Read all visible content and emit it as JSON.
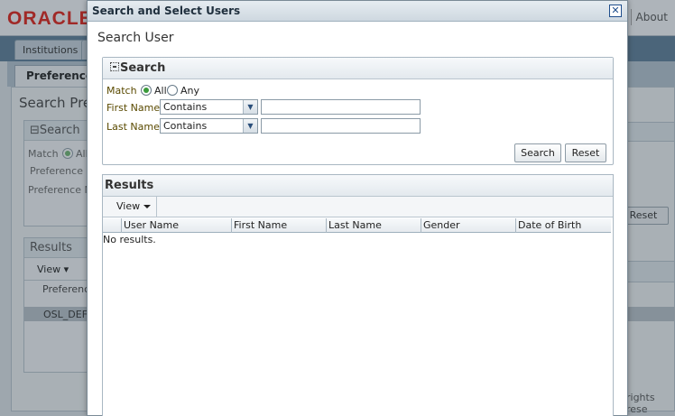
{
  "background_app": {
    "logo_text": "ORACLE",
    "about_link": "About",
    "tabs": [
      "Institutions"
    ],
    "subtab": "Preference",
    "page_title": "Search Pre",
    "search_box_title": "Search",
    "match_label": "Match",
    "match_all": "All",
    "pref_label_1": "Preference C",
    "pref_label_2": "Preference Na",
    "reset_button": "Reset",
    "results_title": "Results",
    "view_menu": "View",
    "column_preference": "Preferenc",
    "row_value": "OSL_DEFA",
    "footer_text": "rights rese"
  },
  "dialog": {
    "title": "Search and Select Users",
    "close_glyph": "✕",
    "heading": "Search User",
    "search_panel": {
      "title": "Search",
      "match_label": "Match",
      "match_options": [
        {
          "label": "All",
          "selected": true
        },
        {
          "label": "Any",
          "selected": false
        }
      ],
      "fields": [
        {
          "label": "First Name",
          "operator": "Contains",
          "value": ""
        },
        {
          "label": "Last Name",
          "operator": "Contains",
          "value": ""
        }
      ],
      "buttons": {
        "search": "Search",
        "reset": "Reset"
      }
    },
    "results_panel": {
      "title": "Results",
      "view_menu": "View",
      "columns": [
        "User Name",
        "First Name",
        "Last Name",
        "Gender",
        "Date of Birth"
      ],
      "empty_text": "No results."
    }
  },
  "colors": {
    "logo_red": "#e0231a",
    "label_text": "#5a4a00",
    "radio_selected": "#3a9a3a"
  }
}
